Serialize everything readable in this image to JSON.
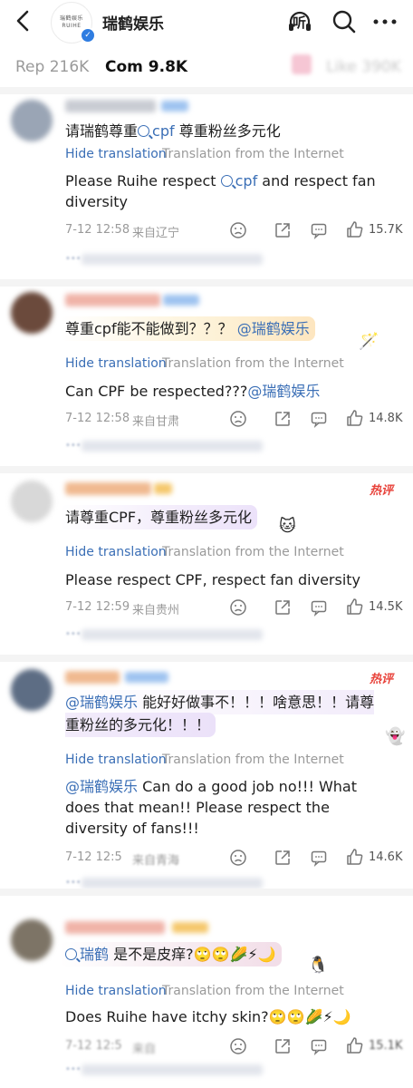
{
  "header": {
    "account_name": "瑞鹤娱乐",
    "logo_text": "瑞鹤娱乐\nRUIHE",
    "listen_label": "听"
  },
  "tabs": {
    "rep": "Rep 216K",
    "com": "Com 9.8K",
    "like": "Like 390K"
  },
  "translation": {
    "hide": "Hide translation",
    "source": "Translation from the Internet"
  },
  "comments": [
    {
      "text_prefix": "请瑞鹤尊重",
      "text_topic": "cpf",
      "text_suffix": "  尊重粉丝多元化",
      "translation_prefix": "Please Ruihe respect ",
      "translation_topic": "cpf",
      "translation_suffix": "  and respect fan diversity",
      "time": "7-12 12:58",
      "location": "来自辽宁",
      "likes": "15.7K"
    },
    {
      "text_main": "尊重cpf能不能做到？？？",
      "text_mention": "@瑞鹤娱乐",
      "translation_main": "Can CPF be respected???",
      "translation_mention": "@瑞鹤娱乐",
      "time": "7-12 12:58",
      "location": "来自甘肃",
      "likes": "14.8K"
    },
    {
      "text_main": "请尊重CPF，尊重粉丝多元化",
      "translation": "Please respect CPF, respect fan diversity",
      "time": "7-12 12:59",
      "location": "来自贵州",
      "likes": "14.5K",
      "hot": "热评"
    },
    {
      "text_mention": "@瑞鹤娱乐",
      "text_main": " 能好好做事不！！！啥意思！！请尊重粉丝的多元化！！！",
      "translation_mention": "@瑞鹤娱乐",
      "translation_main": " Can do a good job no!!! What does that mean!! Please respect the diversity of fans!!!",
      "time": "7-12 12:5",
      "location": "来自青海",
      "likes": "14.6K",
      "hot": "热评"
    },
    {
      "text_topic": "瑞鹤",
      "text_main": " 是不是皮痒?",
      "text_emoji": "🙄🙄🌽⚡🌙",
      "translation_main": "Does Ruihe have itchy skin?",
      "translation_emoji": "🙄🙄🌽⚡🌙",
      "time": "7-12 12:5",
      "location": "来自",
      "likes": "15.1K"
    }
  ],
  "colors": {
    "link": "#3b6fb6",
    "hot": "#e8423a",
    "muted": "#9a9a9a"
  }
}
